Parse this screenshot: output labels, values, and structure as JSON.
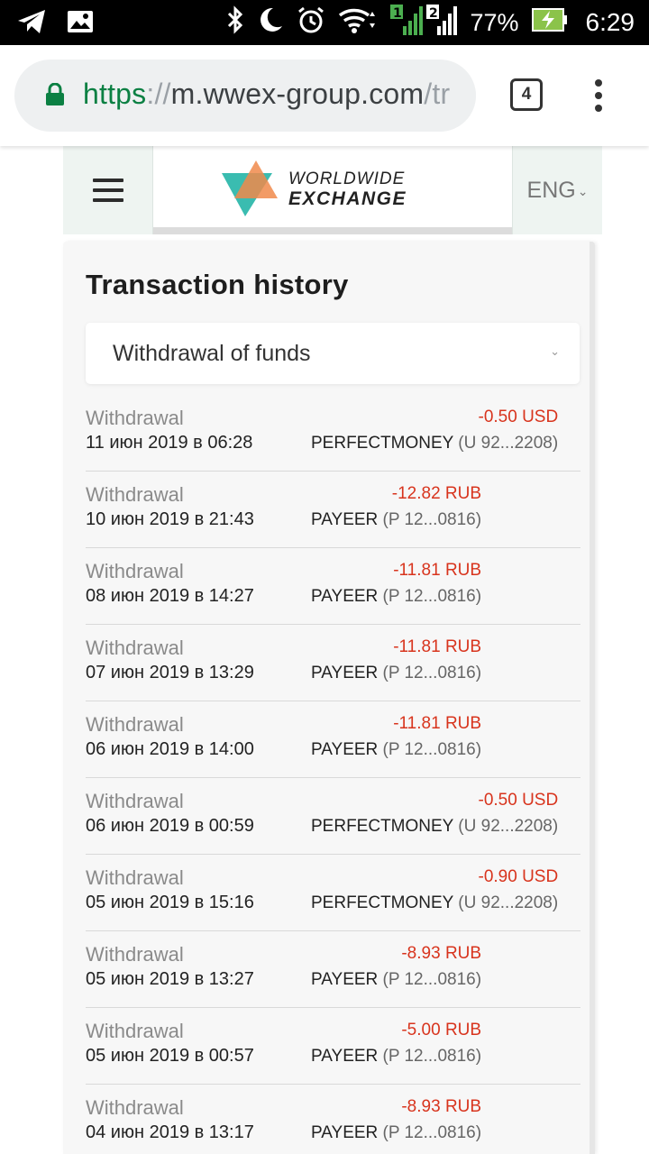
{
  "status_bar": {
    "battery_percent": "77%",
    "time": "6:29",
    "sim1_label": "1",
    "sim2_label": "2",
    "icons": [
      "telegram-icon",
      "image-icon",
      "bluetooth-icon",
      "moon-icon",
      "alarm-icon",
      "wifi-icon",
      "signal-icon",
      "battery-charging-icon"
    ]
  },
  "browser": {
    "url_scheme": "https",
    "url_sep": "://",
    "url_host": "m.wwex-group.com",
    "url_rest": "/tr",
    "tab_count": "4",
    "secure_color": "#0b8043"
  },
  "site_header": {
    "logo_line1": "WORLDWIDE",
    "logo_line2": "EXCHANGE",
    "language": "ENG"
  },
  "page": {
    "title": "Transaction history",
    "filter": {
      "selected": "Withdrawal of funds"
    }
  },
  "colors": {
    "negative_amount": "#d8341d",
    "logo_orange": "#f08a4b",
    "logo_teal": "#2fb8ac"
  },
  "transactions": [
    {
      "type": "Withdrawal",
      "date": "11 июн 2019 в 06:28",
      "amount": "-0.50 USD",
      "method": "PERFECTMONEY",
      "account": "(U 92...2208)"
    },
    {
      "type": "Withdrawal",
      "date": "10 июн 2019 в 21:43",
      "amount": "-12.82 RUB",
      "method": "PAYEER",
      "account": "(P 12...0816)"
    },
    {
      "type": "Withdrawal",
      "date": "08 июн 2019 в 14:27",
      "amount": "-11.81 RUB",
      "method": "PAYEER",
      "account": "(P 12...0816)"
    },
    {
      "type": "Withdrawal",
      "date": "07 июн 2019 в 13:29",
      "amount": "-11.81 RUB",
      "method": "PAYEER",
      "account": "(P 12...0816)"
    },
    {
      "type": "Withdrawal",
      "date": "06 июн 2019 в 14:00",
      "amount": "-11.81 RUB",
      "method": "PAYEER",
      "account": "(P 12...0816)"
    },
    {
      "type": "Withdrawal",
      "date": "06 июн 2019 в 00:59",
      "amount": "-0.50 USD",
      "method": "PERFECTMONEY",
      "account": "(U 92...2208)"
    },
    {
      "type": "Withdrawal",
      "date": "05 июн 2019 в 15:16",
      "amount": "-0.90 USD",
      "method": "PERFECTMONEY",
      "account": "(U 92...2208)"
    },
    {
      "type": "Withdrawal",
      "date": "05 июн 2019 в 13:27",
      "amount": "-8.93 RUB",
      "method": "PAYEER",
      "account": "(P 12...0816)"
    },
    {
      "type": "Withdrawal",
      "date": "05 июн 2019 в 00:57",
      "amount": "-5.00 RUB",
      "method": "PAYEER",
      "account": "(P 12...0816)"
    },
    {
      "type": "Withdrawal",
      "date": "04 июн 2019 в 13:17",
      "amount": "-8.93 RUB",
      "method": "PAYEER",
      "account": "(P 12...0816)"
    }
  ]
}
